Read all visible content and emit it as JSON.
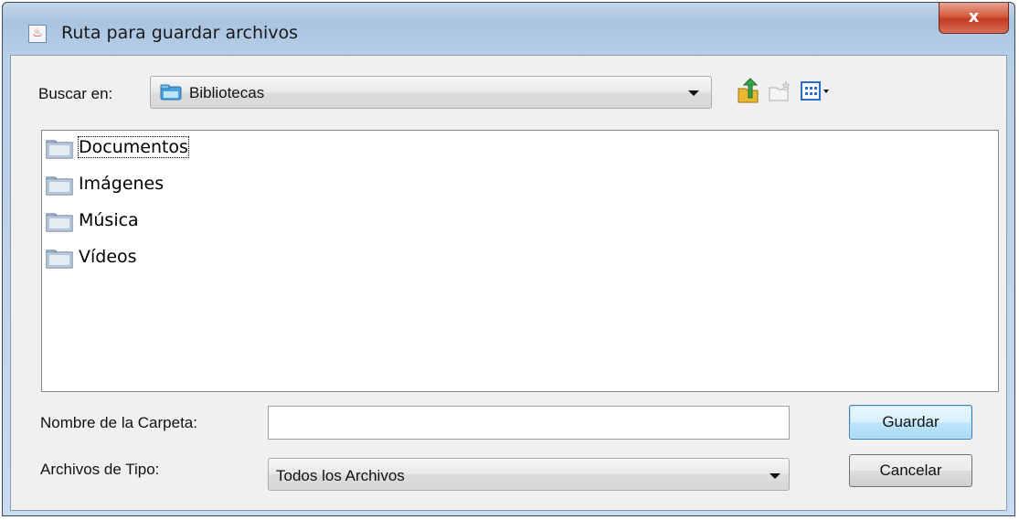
{
  "window": {
    "title": "Ruta para guardar archivos",
    "close_glyph": "x"
  },
  "lookin": {
    "label": "Buscar en:",
    "value": "Bibliotecas"
  },
  "toolbar": {
    "icons": [
      "up-folder-icon",
      "new-folder-icon",
      "list-view-icon"
    ]
  },
  "files": [
    {
      "name": "Documentos"
    },
    {
      "name": "Imágenes"
    },
    {
      "name": "Música"
    },
    {
      "name": "Vídeos"
    }
  ],
  "folder_name": {
    "label": "Nombre de la Carpeta:",
    "value": ""
  },
  "file_type": {
    "label": "Archivos de Tipo:",
    "value": "Todos los Archivos"
  },
  "buttons": {
    "save": "Guardar",
    "cancel": "Cancelar"
  },
  "colors": {
    "title_bar": "#b8cfe8",
    "close_button": "#c23b1e",
    "default_button": "#3c7fb1",
    "panel": "#f0f0f0"
  }
}
